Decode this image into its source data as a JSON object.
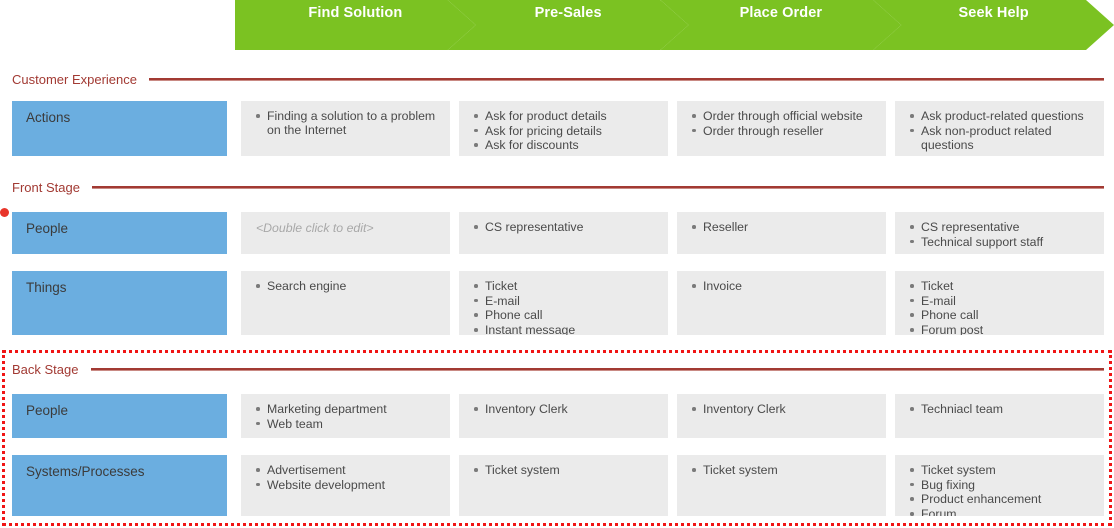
{
  "banner": {
    "stages": [
      {
        "label": "Find Solution"
      },
      {
        "label": "Pre-Sales"
      },
      {
        "label": "Place Order"
      },
      {
        "label": "Seek Help"
      }
    ],
    "color": "#7BC222"
  },
  "colors": {
    "stage_green": "#7BC222",
    "row_label_blue": "#6BAEE0",
    "cell_gray": "#EBEBEB",
    "section_maroon": "#A23A33",
    "selection_red": "#F01414"
  },
  "sections": [
    {
      "id": "customer-experience",
      "label": "Customer Experience",
      "rows": [
        {
          "id": "actions",
          "label": "Actions",
          "cells": [
            {
              "items": [
                "Finding a solution to a problem on the Internet"
              ]
            },
            {
              "items": [
                "Ask for product details",
                "Ask for pricing details",
                "Ask for discounts"
              ]
            },
            {
              "items": [
                "Order through official website",
                "Order through reseller"
              ]
            },
            {
              "items": [
                "Ask product-related questions",
                "Ask non-product related questions"
              ]
            }
          ]
        }
      ]
    },
    {
      "id": "front-stage",
      "label": "Front Stage",
      "rows": [
        {
          "id": "front-people",
          "label": "People",
          "cells": [
            {
              "placeholder": "<Double click to edit>",
              "items": []
            },
            {
              "items": [
                "CS representative"
              ]
            },
            {
              "items": [
                "Reseller"
              ]
            },
            {
              "items": [
                "CS representative",
                "Technical support staff"
              ]
            }
          ]
        },
        {
          "id": "front-things",
          "label": "Things",
          "cells": [
            {
              "items": [
                "Search engine"
              ]
            },
            {
              "items": [
                "Ticket",
                "E-mail",
                "Phone call",
                "Instant message"
              ]
            },
            {
              "items": [
                "Invoice"
              ]
            },
            {
              "items": [
                "Ticket",
                "E-mail",
                "Phone call",
                "Forum post"
              ]
            }
          ]
        }
      ]
    },
    {
      "id": "back-stage",
      "label": "Back Stage",
      "selected": true,
      "rows": [
        {
          "id": "back-people",
          "label": "People",
          "cells": [
            {
              "items": [
                "Marketing department",
                "Web team"
              ]
            },
            {
              "items": [
                "Inventory Clerk"
              ]
            },
            {
              "items": [
                "Inventory Clerk"
              ]
            },
            {
              "items": [
                "Techniacl team"
              ]
            }
          ]
        },
        {
          "id": "back-systems",
          "label": "Systems/Processes",
          "cells": [
            {
              "items": [
                "Advertisement",
                "Website development"
              ]
            },
            {
              "items": [
                "Ticket system"
              ]
            },
            {
              "items": [
                "Ticket system"
              ]
            },
            {
              "items": [
                "Ticket system",
                "Bug fixing",
                "Product enhancement",
                "Forum"
              ]
            }
          ]
        }
      ]
    }
  ]
}
